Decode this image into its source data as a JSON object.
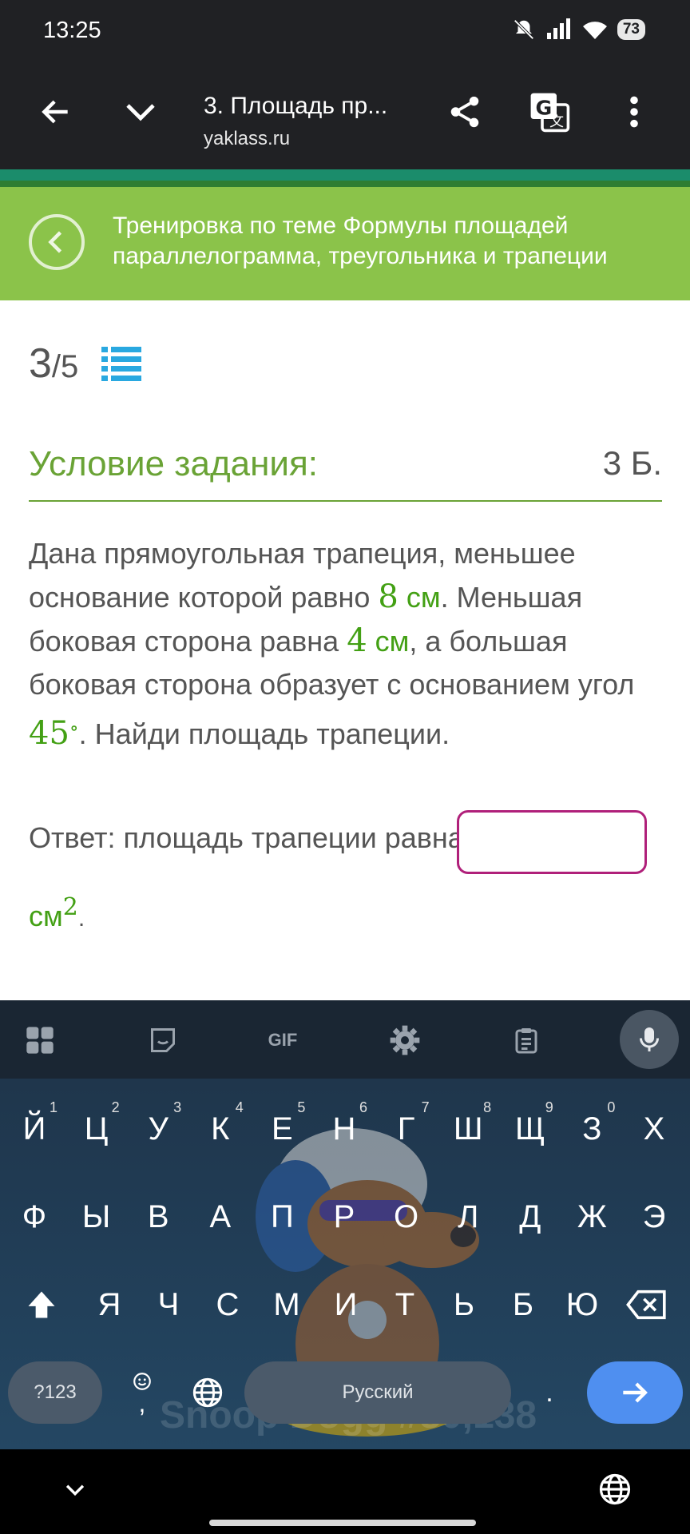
{
  "status_bar": {
    "time": "13:25",
    "battery": "73",
    "icons": [
      "bell-off-icon",
      "signal-icon",
      "wifi-icon",
      "battery-icon"
    ]
  },
  "browser": {
    "title": "3. Площадь пр...",
    "url": "yaklass.ru",
    "icons": [
      "back-arrow-icon",
      "chevron-down-icon",
      "share-icon",
      "translate-icon",
      "more-vertical-icon"
    ]
  },
  "topic": {
    "title": "Тренировка по теме Формулы площадей параллелограмма, треугольника и трапеции"
  },
  "progress": {
    "current": "3",
    "separator": "/",
    "total": "5"
  },
  "task": {
    "heading": "Условие задания:",
    "points": "3 Б.",
    "text": {
      "p1": "Дана прямоугольная трапеция, меньшее основание которой равно ",
      "v1": "8",
      "u1": " см",
      "p2": ". Меньшая боковая сторона равна ",
      "v2": "4",
      "u2": " см",
      "p3": ", а большая боковая сторона образует с основанием угол ",
      "v3": "45",
      "deg": "∘",
      "p4": ". Найди площадь трапеции."
    }
  },
  "answer": {
    "label": "Ответ: площадь трапеции равна",
    "value": "",
    "unit": "см",
    "unit_power": "2",
    "unit_suffix": "."
  },
  "keyboard": {
    "toolbar": [
      "apps-icon",
      "sticker-icon",
      "GIF",
      "settings-icon",
      "clipboard-icon",
      "microphone-icon"
    ],
    "gif_label": "GIF",
    "row1": [
      {
        "k": "Й",
        "n": "1"
      },
      {
        "k": "Ц",
        "n": "2"
      },
      {
        "k": "У",
        "n": "3"
      },
      {
        "k": "К",
        "n": "4"
      },
      {
        "k": "Е",
        "n": "5"
      },
      {
        "k": "Н",
        "n": "6"
      },
      {
        "k": "Г",
        "n": "7"
      },
      {
        "k": "Ш",
        "n": "8"
      },
      {
        "k": "Щ",
        "n": "9"
      },
      {
        "k": "З",
        "n": "0"
      },
      {
        "k": "Х",
        "n": ""
      }
    ],
    "row2": [
      "Ф",
      "Ы",
      "В",
      "А",
      "П",
      "Р",
      "О",
      "Л",
      "Д",
      "Ж",
      "Э"
    ],
    "row3": [
      "Я",
      "Ч",
      "С",
      "М",
      "И",
      "Т",
      "Ь",
      "Б",
      "Ю"
    ],
    "sym_label": "?123",
    "comma": ",",
    "space_label": "Русский",
    "period": ".",
    "wallpaper_text": "Snoop Dogg #80,138"
  },
  "colors": {
    "accent_green": "#8bc34a",
    "heading_green": "#6aa336",
    "math_green": "#43a014",
    "input_border": "#b0207a",
    "enter_key": "#4f8ff0"
  }
}
